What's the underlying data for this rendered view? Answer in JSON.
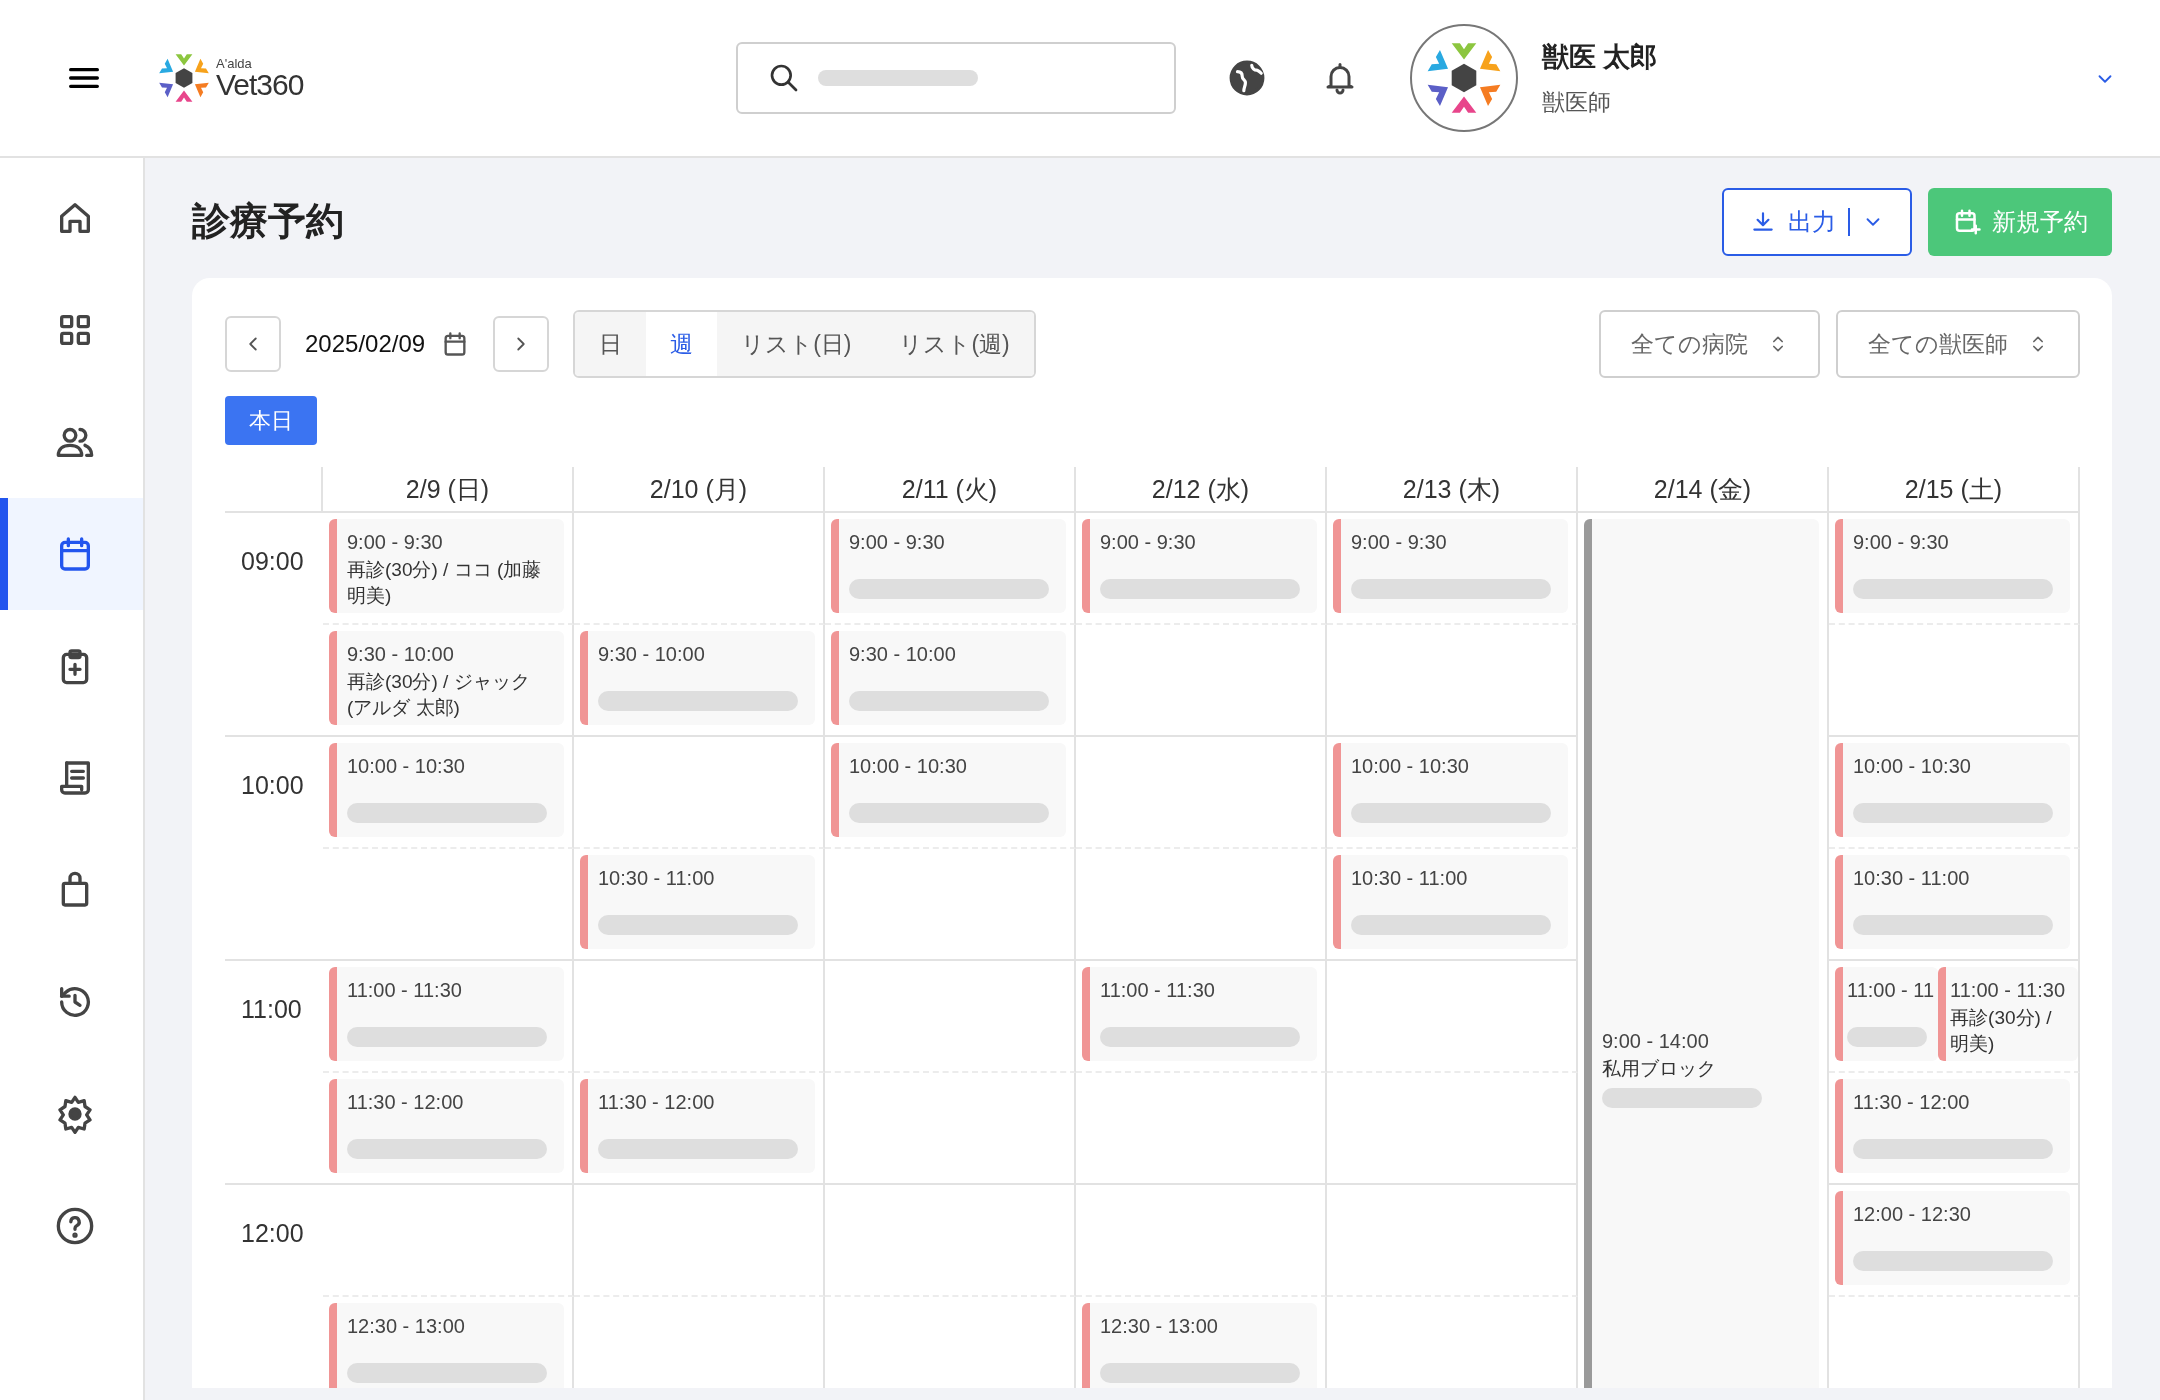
{
  "header": {
    "brand_small": "A'alda",
    "brand": "Vet360",
    "user": {
      "name": "獣医 太郎",
      "role": "獣医師"
    }
  },
  "sidebar": {
    "items": [
      {
        "kind": "home",
        "selected": false
      },
      {
        "kind": "grid",
        "selected": false
      },
      {
        "kind": "users",
        "selected": false
      },
      {
        "kind": "calendar",
        "selected": true
      },
      {
        "kind": "clipboard",
        "selected": false
      },
      {
        "kind": "receipt",
        "selected": false
      },
      {
        "kind": "bag",
        "selected": false
      },
      {
        "kind": "history",
        "selected": false
      },
      {
        "kind": "settings",
        "selected": false
      },
      {
        "kind": "help",
        "selected": false
      }
    ]
  },
  "page": {
    "title": "診療予約",
    "export_button": "出力",
    "new_button": "新規予約"
  },
  "toolbar": {
    "date": "2025/02/09",
    "views": [
      {
        "label": "日",
        "selected": false
      },
      {
        "label": "週",
        "selected": true
      },
      {
        "label": "リスト(日)",
        "selected": false
      },
      {
        "label": "リスト(週)",
        "selected": false
      }
    ],
    "filters": [
      "全ての病院",
      "全ての獣医師"
    ],
    "today_button": "本日"
  },
  "calendar": {
    "times": [
      "09:00",
      "10:00",
      "11:00",
      "12:00"
    ],
    "days": [
      {
        "label": "2/9 (日)",
        "events": [
          {
            "kind": "appointment",
            "time": "9:00 - 9:30",
            "detail": "再診(30分) / ココ (加藤明美)",
            "loading": false
          },
          {
            "kind": "appointment",
            "time": "9:30 - 10:00",
            "detail": "再診(30分) / ジャック (アルダ 太郎)",
            "loading": false
          },
          {
            "kind": "appointment",
            "time": "10:00 - 10:30",
            "loading": true
          },
          {
            "kind": "appointment",
            "time": "11:00 - 11:30",
            "loading": true
          },
          {
            "kind": "appointment",
            "time": "11:30 - 12:00",
            "loading": true
          },
          {
            "kind": "appointment",
            "time": "12:30 - 13:00",
            "loading": true
          }
        ]
      },
      {
        "label": "2/10 (月)",
        "events": [
          {
            "kind": "appointment",
            "time": "9:30 - 10:00",
            "loading": true
          },
          {
            "kind": "appointment",
            "time": "10:30 - 11:00",
            "loading": true
          },
          {
            "kind": "appointment",
            "time": "11:30 - 12:00",
            "loading": true
          }
        ]
      },
      {
        "label": "2/11 (火)",
        "events": [
          {
            "kind": "appointment",
            "time": "9:00 - 9:30",
            "loading": true
          },
          {
            "kind": "appointment",
            "time": "9:30 - 10:00",
            "loading": true
          },
          {
            "kind": "appointment",
            "time": "10:00 - 10:30",
            "loading": true
          }
        ]
      },
      {
        "label": "2/12 (水)",
        "events": [
          {
            "kind": "appointment",
            "time": "9:00 - 9:30",
            "loading": true
          },
          {
            "kind": "appointment",
            "time": "11:00 - 11:30",
            "loading": true
          },
          {
            "kind": "appointment",
            "time": "12:30 - 13:00",
            "loading": true
          }
        ]
      },
      {
        "label": "2/13 (木)",
        "events": [
          {
            "kind": "appointment",
            "time": "9:00 - 9:30",
            "loading": true
          },
          {
            "kind": "appointment",
            "time": "10:00 - 10:30",
            "loading": true
          },
          {
            "kind": "appointment",
            "time": "10:30 - 11:00",
            "loading": true
          }
        ]
      },
      {
        "label": "2/14 (金)",
        "events": [
          {
            "kind": "block",
            "time": "9:00 - 14:00",
            "detail": "私用ブロック",
            "loading": true
          }
        ]
      },
      {
        "label": "2/15 (土)",
        "events": [
          {
            "kind": "appointment",
            "time": "9:00 - 9:30",
            "loading": true
          },
          {
            "kind": "appointment",
            "time": "10:00 - 10:30",
            "loading": true
          },
          {
            "kind": "appointment",
            "time": "10:30 - 11:00",
            "loading": true
          },
          {
            "kind": "appointment",
            "time": "11:00 - 11",
            "loading": true
          },
          {
            "kind": "appointment",
            "time": "11:00 - 11:30",
            "detail": "再診(30分) /\n明美)",
            "loading": false
          },
          {
            "kind": "appointment",
            "time": "11:30 - 12:00",
            "loading": true
          },
          {
            "kind": "appointment",
            "time": "12:00 - 12:30",
            "loading": true
          }
        ]
      }
    ]
  }
}
